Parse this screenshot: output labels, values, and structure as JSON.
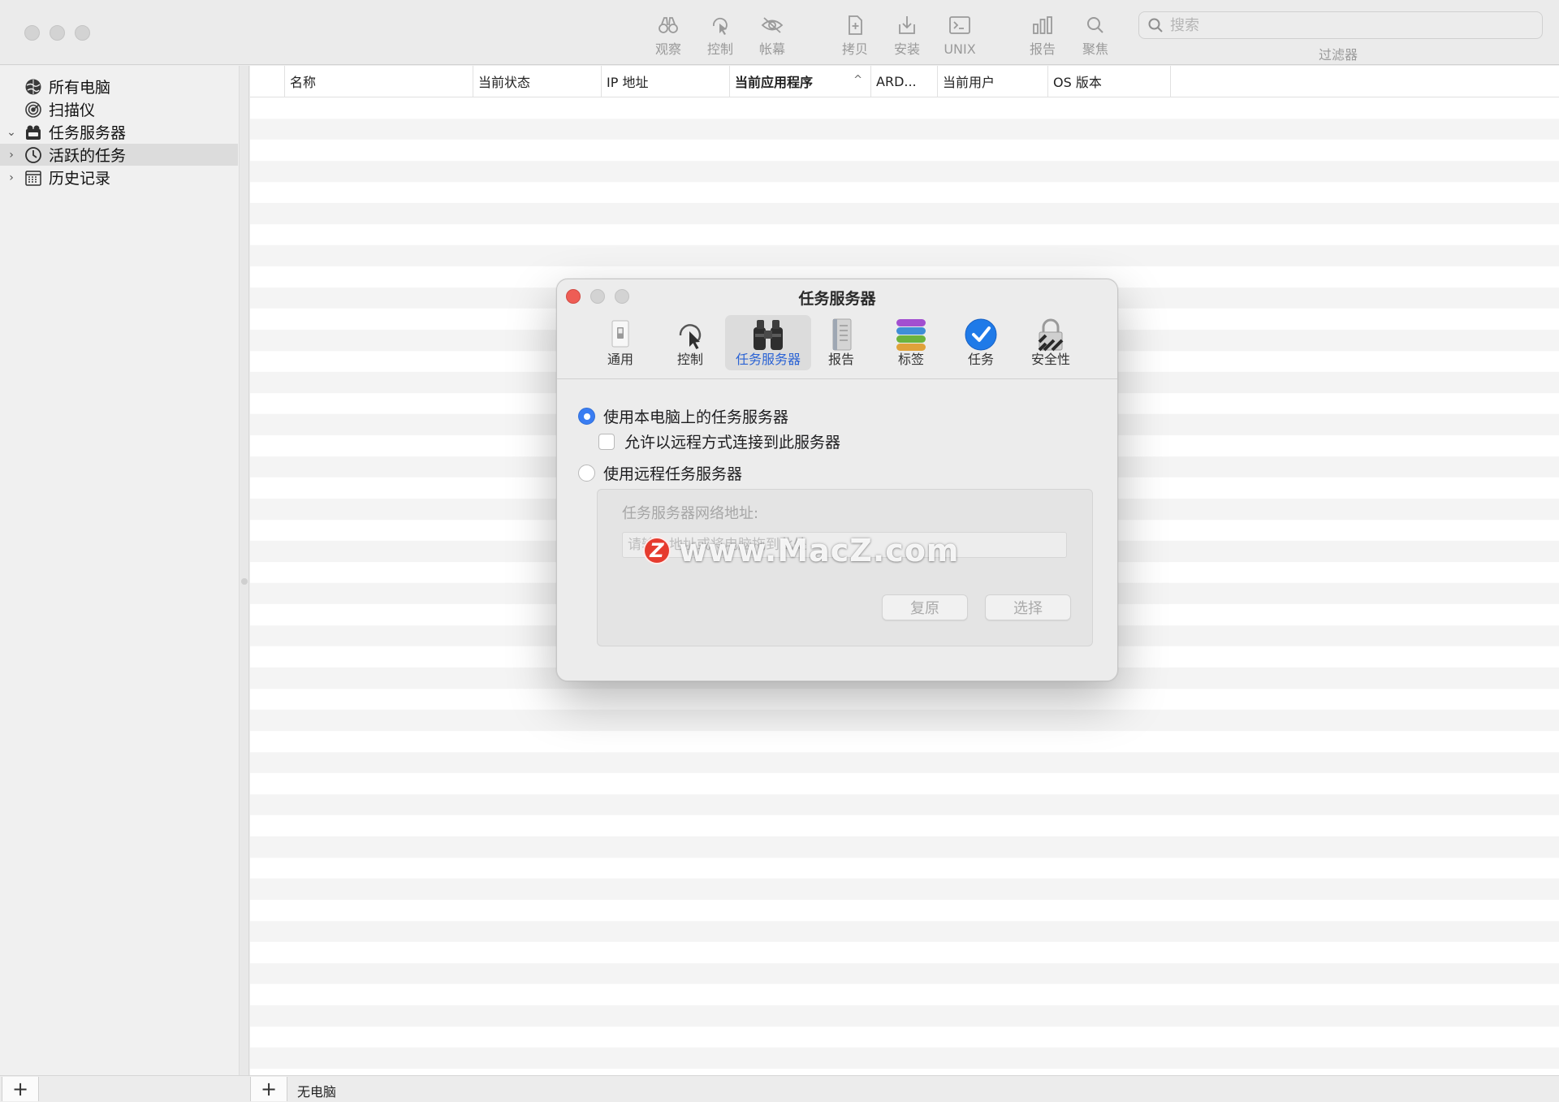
{
  "toolbar": {
    "observe": "观察",
    "control": "控制",
    "curtain": "帐幕",
    "copy": "拷贝",
    "install": "安装",
    "unix": "UNIX",
    "report": "报告",
    "spotlight": "聚焦",
    "search_placeholder": "搜索",
    "filter_label": "过滤器"
  },
  "sidebar": {
    "items": [
      {
        "label": "所有电脑",
        "icon": "globe-icon",
        "expandable": false
      },
      {
        "label": "扫描仪",
        "icon": "scanner-icon",
        "expandable": false
      },
      {
        "label": "任务服务器",
        "icon": "task-server-icon",
        "expandable": true,
        "expanded": true
      },
      {
        "label": "活跃的任务",
        "icon": "clock-icon",
        "expandable": true,
        "selected": true
      },
      {
        "label": "历史记录",
        "icon": "calendar-icon",
        "expandable": true
      }
    ]
  },
  "table": {
    "columns": [
      "名称",
      "当前状态",
      "IP 地址",
      "当前应用程序",
      "ARD...",
      "当前用户",
      "OS 版本"
    ],
    "sorted_column": "当前应用程序",
    "sort_direction": "ascending"
  },
  "statusbar": {
    "status": "无电脑"
  },
  "dialog": {
    "title": "任务服务器",
    "tabs": [
      "通用",
      "控制",
      "任务服务器",
      "报告",
      "标签",
      "任务",
      "安全性"
    ],
    "active_tab": "任务服务器",
    "option_local": "使用本电脑上的任务服务器",
    "option_allow_remote": "允许以远程方式连接到此服务器",
    "option_remote": "使用远程任务服务器",
    "remote_address_label": "任务服务器网络地址:",
    "remote_address_placeholder": "请输入地址或将电脑拖到此处",
    "reset_button": "复原",
    "choose_button": "选择",
    "local_selected": true,
    "allow_remote_checked": false
  },
  "watermark": {
    "logo_letter": "Z",
    "text": "www.MacZ.com"
  },
  "colors": {
    "accent": "#3a7df2",
    "active_tab_text": "#2b63d4",
    "close_red": "#ee5d55"
  }
}
